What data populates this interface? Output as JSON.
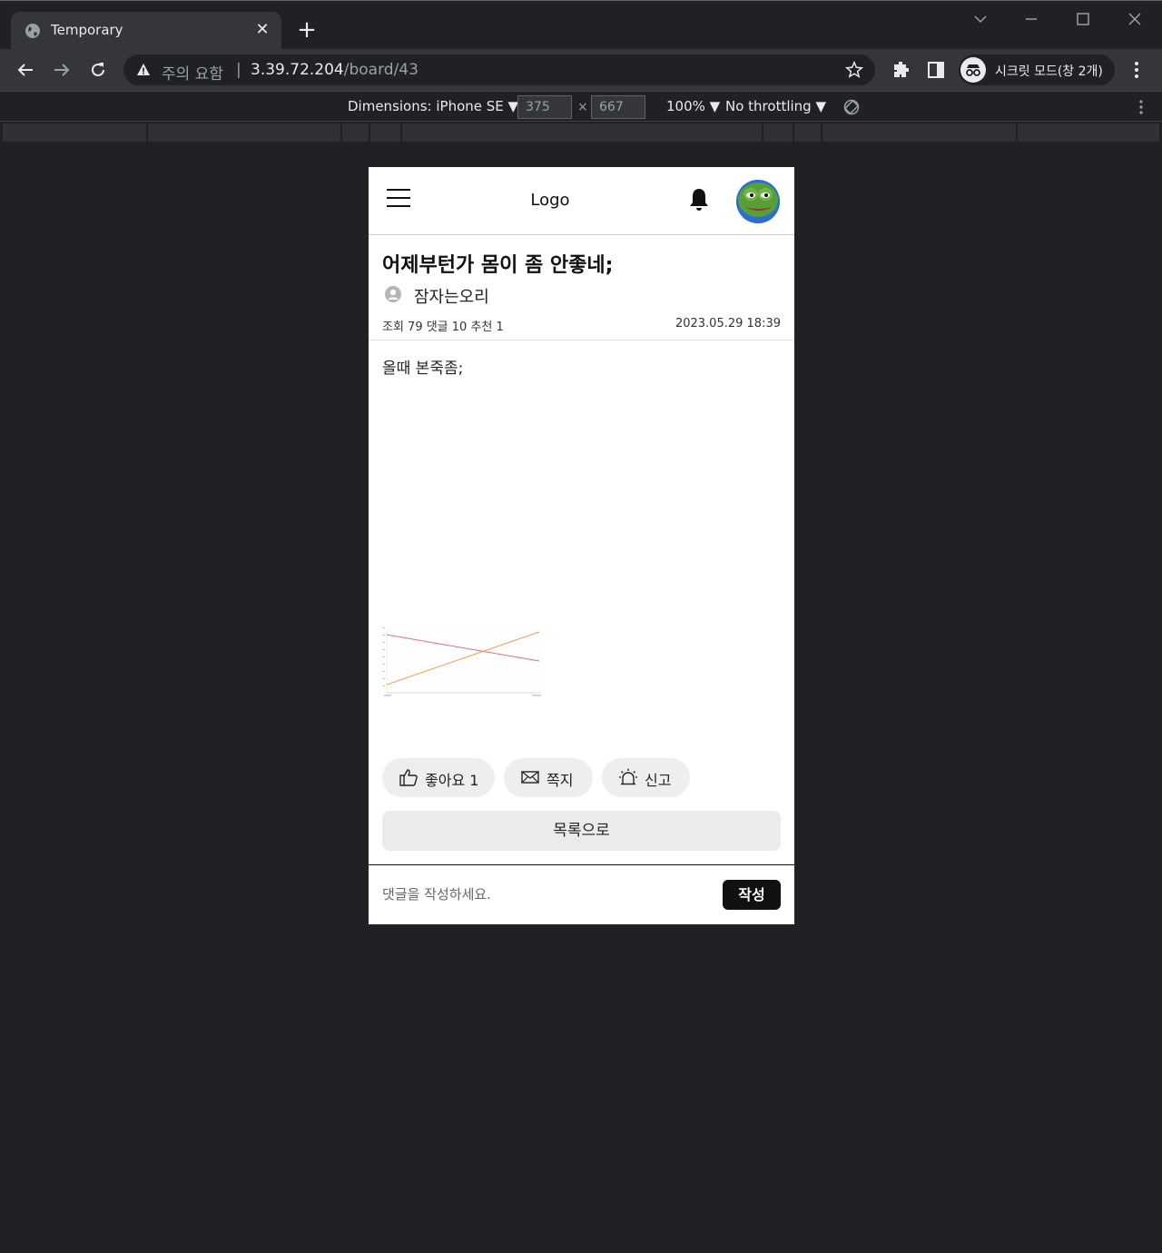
{
  "browser": {
    "tab_title": "Temporary",
    "omnibox": {
      "warning_text": "주의 요함",
      "separator": "|",
      "host": "3.39.72.204",
      "path": "/board/43"
    },
    "incognito_label": "시크릿 모드(창 2개)"
  },
  "devtools": {
    "dimensions_label": "Dimensions: iPhone SE ▼",
    "width": "375",
    "height": "667",
    "times": "×",
    "zoom": "100% ▼",
    "throttling": "No throttling ▼"
  },
  "page": {
    "logo": "Logo",
    "post": {
      "title": "어제부턴가 몸이 좀 안좋네;",
      "author": "잠자는오리",
      "meta": "조회 79 댓글 10 추천 1",
      "date": "2023.05.29 18:39",
      "body": "올때 본죽좀;"
    },
    "actions": {
      "like": "좋아요 1",
      "message": "쪽지",
      "report": "신고"
    },
    "list_button": "목록으로",
    "comment": {
      "placeholder": "댓글을 작성하세요.",
      "submit": "작성"
    }
  },
  "colors": {
    "chrome_dark": "#202124",
    "chrome_toolbar": "#35363a",
    "chart_line_red": "#e86a8a",
    "chart_line_orange": "#f0a050"
  }
}
